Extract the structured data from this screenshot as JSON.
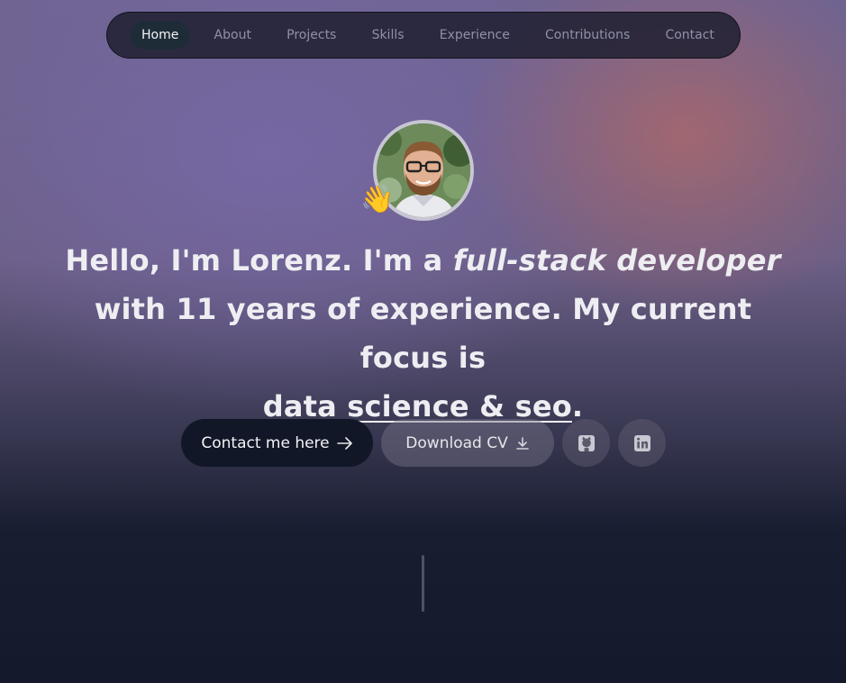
{
  "nav": {
    "items": [
      {
        "label": "Home",
        "active": true
      },
      {
        "label": "About"
      },
      {
        "label": "Projects"
      },
      {
        "label": "Skills"
      },
      {
        "label": "Experience"
      },
      {
        "label": "Contributions"
      },
      {
        "label": "Contact"
      }
    ]
  },
  "hero": {
    "wave_emoji": "👋",
    "greeting": "Hello, I'm Lorenz.",
    "role_prefix": " I'm a ",
    "role": "full-stack developer",
    "with": "with ",
    "years": "11 years",
    "focus_text": " of experience. My current focus is",
    "focus": "data science & seo",
    "period": "."
  },
  "actions": {
    "contact_label": "Contact me here",
    "contact_icon": "arrow-right-icon",
    "cv_label": "Download CV",
    "cv_icon": "download-icon",
    "github_icon": "github-icon",
    "linkedin_icon": "linkedin-icon"
  },
  "colors": {
    "accent_dark": "#111727",
    "background": "#141a2c"
  }
}
